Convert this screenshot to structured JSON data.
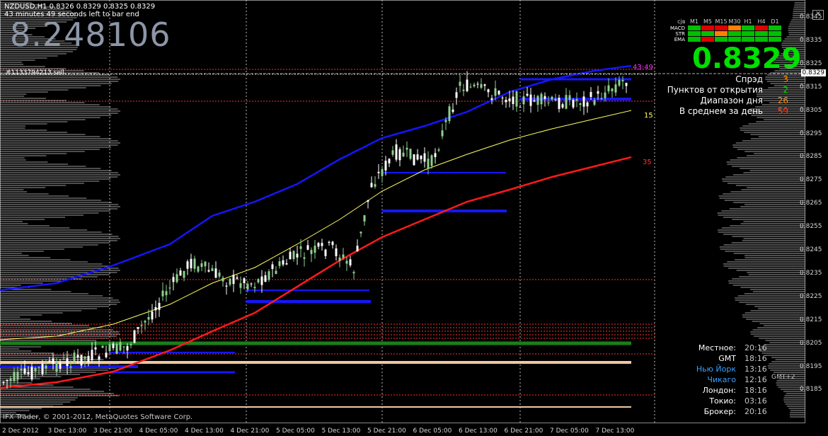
{
  "header": {
    "symbol_line": "NZDUSD,H1  0.8326 0.8329 0.8325 0.8329",
    "timer_line": "43 minutes 49 seconds left to bar end",
    "big_number": "8.248106",
    "trade_label": "#1133794213 sell",
    "copyright": "IFX Trader, © 2001-2012, MetaQuotes Software Corp."
  },
  "price_axis": {
    "labels": [
      "0.8345",
      "0.8335",
      "0.8325",
      "0.8315",
      "0.8305",
      "0.8295",
      "0.8285",
      "0.8275",
      "0.8265",
      "0.8255",
      "0.8245",
      "0.8235",
      "0.8225",
      "0.8215",
      "0.8205",
      "0.8195",
      "0.8185"
    ],
    "current_price_label": "0.8329"
  },
  "time_axis": {
    "labels": [
      "2 Dec 2012",
      "3 Dec 13:00",
      "3 Dec 21:00",
      "4 Dec 05:00",
      "4 Dec 13:00",
      "4 Dec 21:00",
      "5 Dec 05:00",
      "5 Dec 13:00",
      "5 Dec 21:00",
      "6 Dec 05:00",
      "6 Dec 13:00",
      "6 Dec 21:00",
      "7 Dec 05:00",
      "7 Dec 13:00"
    ]
  },
  "dashboard": {
    "symbol_abbr": "сјв",
    "timeframes": [
      "M1",
      "M5",
      "M15",
      "M30",
      "H1",
      "H4",
      "D1"
    ],
    "rows": [
      {
        "name": "MACD",
        "colors": [
          "#00c000",
          "#e00000",
          "#e00000",
          "#ff8000",
          "#00c000",
          "#e00000",
          "#00c000"
        ]
      },
      {
        "name": "STR",
        "colors": [
          "#00c000",
          "#00c000",
          "#ff8000",
          "#00c000",
          "#00c000",
          "#00c000",
          "#00c000"
        ]
      },
      {
        "name": "EMA",
        "colors": [
          "#00c000",
          "#e00000",
          "#00c000",
          "#00c000",
          "#00c000",
          "#00c000",
          "#00c000"
        ]
      }
    ],
    "current_price": "0.8329",
    "stats": [
      {
        "label": "Спрэд",
        "value": "3",
        "color": "#ff8c00"
      },
      {
        "label": "Пунктов от открытия",
        "value": "2",
        "color": "#00e000"
      },
      {
        "label": "Диапазон дня",
        "value": "26",
        "color": "#ff8c00"
      },
      {
        "label": "В среднем за день",
        "value": "59",
        "color": "#ff4020"
      }
    ]
  },
  "level_labels": {
    "top": "43:49",
    "mid": "15",
    "low": "35"
  },
  "clock": {
    "rows": [
      {
        "label": "Местное:",
        "time": "20:16",
        "color": "#ffffff"
      },
      {
        "label": "GMT",
        "time": "18:16",
        "color": "#ffffff"
      },
      {
        "label": "Нью Йорк",
        "time": "13:16",
        "color": "#3aa0ff"
      },
      {
        "label": "Чикаго",
        "time": "12:16",
        "color": "#3aa0ff"
      },
      {
        "label": "Лондон:",
        "time": "18:16",
        "color": "#ffffff"
      },
      {
        "label": "Токио:",
        "time": "03:16",
        "color": "#ffffff"
      },
      {
        "label": "Брокер:",
        "time": "20:16",
        "color": "#ffffff"
      }
    ],
    "overlay": "GMT+2"
  },
  "colors": {
    "background": "#000000",
    "bull_candle": "#8fd08f",
    "bear_candle": "#ffffff",
    "upper_ma": "#1515ff",
    "mid_ma": "#ffff60",
    "lower_ma": "#ff1a1a",
    "current_price": "#00e000"
  }
}
